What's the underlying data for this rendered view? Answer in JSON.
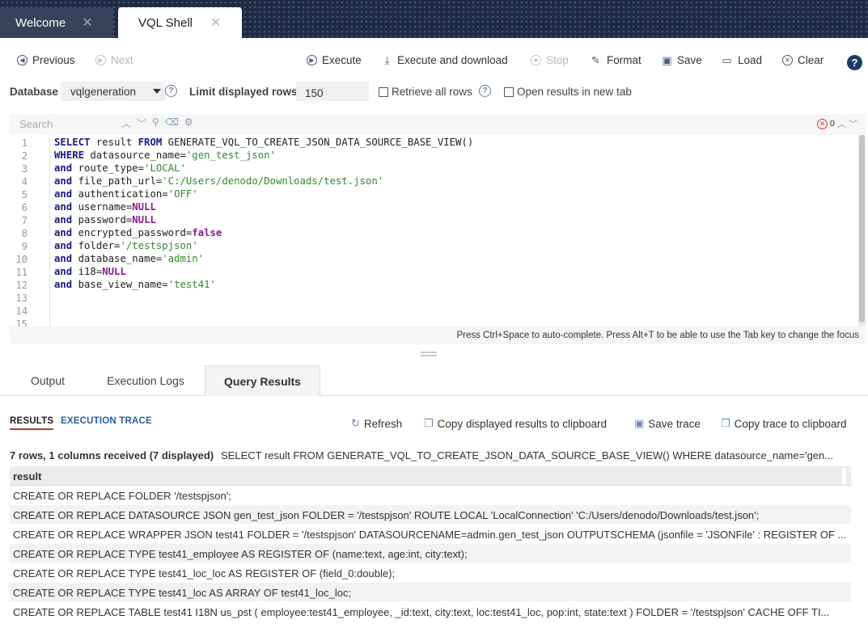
{
  "tabs": [
    {
      "label": "Welcome",
      "close": "✕"
    },
    {
      "label": "VQL Shell",
      "close": "✕"
    }
  ],
  "toolbar": {
    "previous": "Previous",
    "next": "Next",
    "execute": "Execute",
    "execute_download": "Execute and download",
    "stop": "Stop",
    "format": "Format",
    "save": "Save",
    "load": "Load",
    "clear": "Clear",
    "help": "?"
  },
  "db_row": {
    "database_label": "Database",
    "database_value": "vqlgeneration",
    "limit_label": "Limit displayed rows",
    "limit_value": "150",
    "retrieve_all": "Retrieve all rows",
    "open_new_tab": "Open results in new tab"
  },
  "editor": {
    "search_placeholder": "Search",
    "error_count": "0",
    "hint": "Press Ctrl+Space to auto-complete. Press Alt+T to be able to use the Tab key to change the focus",
    "line_numbers": [
      "1",
      "2",
      "3",
      "4",
      "5",
      "6",
      "7",
      "8",
      "9",
      "10",
      "11",
      "12",
      "13",
      "14",
      "15"
    ],
    "lines": [
      [
        {
          "t": "SELECT",
          "c": "kw"
        },
        {
          "t": " result ",
          "c": ""
        },
        {
          "t": "FROM",
          "c": "kw"
        },
        {
          "t": " GENERATE_VQL_TO_CREATE_JSON_DATA_SOURCE_BASE_VIEW()",
          "c": ""
        }
      ],
      [
        {
          "t": "WHERE",
          "c": "kw"
        },
        {
          "t": " datasource_name=",
          "c": ""
        },
        {
          "t": "'gen_test_json'",
          "c": "str"
        }
      ],
      [
        {
          "t": "and",
          "c": "kw"
        },
        {
          "t": " route_type=",
          "c": ""
        },
        {
          "t": "'LOCAL'",
          "c": "str"
        }
      ],
      [
        {
          "t": "and",
          "c": "kw"
        },
        {
          "t": " file_path_url=",
          "c": ""
        },
        {
          "t": "'C:/Users/denodo/Downloads/test.json'",
          "c": "str"
        }
      ],
      [
        {
          "t": "and",
          "c": "kw"
        },
        {
          "t": " authentication=",
          "c": ""
        },
        {
          "t": "'OFF'",
          "c": "str"
        }
      ],
      [
        {
          "t": "and",
          "c": "kw"
        },
        {
          "t": " username=",
          "c": ""
        },
        {
          "t": "NULL",
          "c": "nul"
        }
      ],
      [
        {
          "t": "and",
          "c": "kw"
        },
        {
          "t": " password=",
          "c": ""
        },
        {
          "t": "NULL",
          "c": "nul"
        }
      ],
      [
        {
          "t": "and",
          "c": "kw"
        },
        {
          "t": " encrypted_password=",
          "c": ""
        },
        {
          "t": "false",
          "c": "nul"
        }
      ],
      [
        {
          "t": "and",
          "c": "kw"
        },
        {
          "t": " folder=",
          "c": ""
        },
        {
          "t": "'/testspjson'",
          "c": "str"
        }
      ],
      [
        {
          "t": "and",
          "c": "kw"
        },
        {
          "t": " database_name=",
          "c": ""
        },
        {
          "t": "'admin'",
          "c": "str"
        }
      ],
      [
        {
          "t": "and",
          "c": "kw"
        },
        {
          "t": " i18=",
          "c": ""
        },
        {
          "t": "NULL",
          "c": "nul"
        }
      ],
      [
        {
          "t": "and",
          "c": "kw"
        },
        {
          "t": " base_view_name=",
          "c": ""
        },
        {
          "t": "'test41'",
          "c": "str"
        }
      ]
    ]
  },
  "output_tabs": [
    "Output",
    "Execution Logs",
    "Query Results"
  ],
  "results": {
    "subtab_results": "RESULTS",
    "subtab_trace": "EXECUTION TRACE",
    "refresh": "Refresh",
    "copy_results": "Copy displayed results to clipboard",
    "save_trace": "Save trace",
    "copy_trace": "Copy trace to clipboard",
    "summary": "7 rows, 1 columns received (7 displayed)",
    "query": "SELECT result FROM GENERATE_VQL_TO_CREATE_JSON_DATA_SOURCE_BASE_VIEW() WHERE datasource_name='gen...",
    "column": "result",
    "rows": [
      "CREATE OR REPLACE FOLDER '/testspjson';",
      "CREATE OR REPLACE DATASOURCE JSON gen_test_json FOLDER = '/testspjson' ROUTE LOCAL 'LocalConnection' 'C:/Users/denodo/Downloads/test.json';",
      "CREATE OR REPLACE WRAPPER JSON test41 FOLDER = '/testspjson' DATASOURCENAME=admin.gen_test_json OUTPUTSCHEMA (jsonfile = 'JSONFile' : REGISTER OF ...",
      "CREATE OR REPLACE TYPE test41_employee AS REGISTER OF (name:text, age:int, city:text);",
      "CREATE OR REPLACE TYPE test41_loc_loc AS REGISTER OF (field_0:double);",
      "CREATE OR REPLACE TYPE test41_loc AS ARRAY OF test41_loc_loc;",
      "CREATE OR REPLACE TABLE test41 I18N us_pst ( employee:test41_employee, _id:text, city:text, loc:test41_loc, pop:int, state:text ) FOLDER = '/testspjson' CACHE OFF TI..."
    ]
  }
}
